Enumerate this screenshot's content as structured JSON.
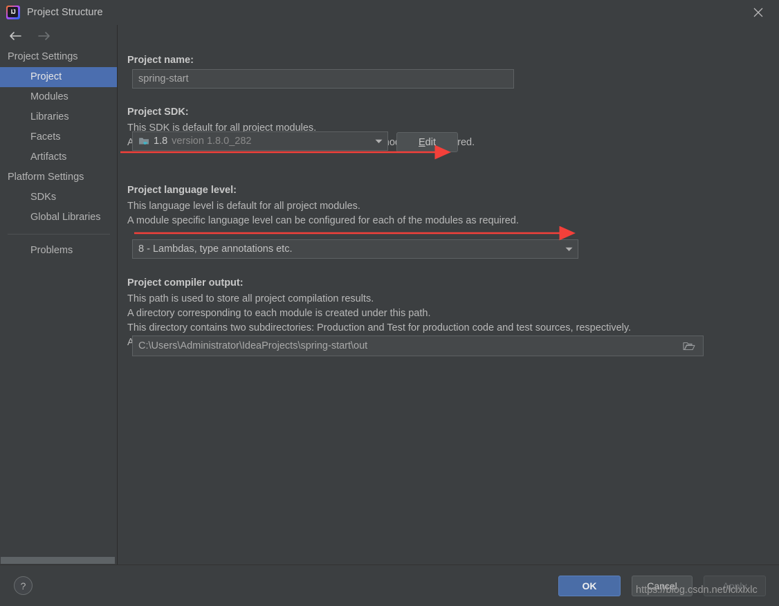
{
  "window": {
    "title": "Project Structure",
    "logo_text": "IJ",
    "logo_icon": "intellij-idea-logo",
    "close_icon": "close-icon"
  },
  "sidebar": {
    "back_icon": "arrow-left-icon",
    "forward_icon": "arrow-right-icon",
    "groups": [
      {
        "label": "Project Settings",
        "items": [
          {
            "label": "Project",
            "selected": true
          },
          {
            "label": "Modules",
            "selected": false
          },
          {
            "label": "Libraries",
            "selected": false
          },
          {
            "label": "Facets",
            "selected": false
          },
          {
            "label": "Artifacts",
            "selected": false
          }
        ]
      },
      {
        "label": "Platform Settings",
        "items": [
          {
            "label": "SDKs",
            "selected": false
          },
          {
            "label": "Global Libraries",
            "selected": false
          }
        ]
      }
    ],
    "extra_items": [
      {
        "label": "Problems",
        "selected": false
      }
    ]
  },
  "main": {
    "project_name": {
      "label": "Project name:",
      "value": "spring-start"
    },
    "project_sdk": {
      "label": "Project SDK:",
      "desc_line1": "This SDK is default for all project modules.",
      "desc_line2": "A module specific SDK can be configured for each of the modules as required.",
      "sdk_icon": "java-sdk-folder-icon",
      "sdk_name": "1.8",
      "sdk_version": "version 1.8.0_282",
      "dropdown_icon": "chevron-down-icon",
      "edit_button_mnemonic": "E",
      "edit_button_rest": "dit"
    },
    "language_level": {
      "label": "Project language level:",
      "desc_line1": "This language level is default for all project modules.",
      "desc_line2": "A module specific language level can be configured for each of the modules as required.",
      "value": "8 - Lambdas, type annotations etc.",
      "dropdown_icon": "chevron-down-icon"
    },
    "compiler_output": {
      "label": "Project compiler output:",
      "desc_line1": "This path is used to store all project compilation results.",
      "desc_line2": "A directory corresponding to each module is created under this path.",
      "desc_line3": "This directory contains two subdirectories: Production and Test for production code and test sources, respectively.",
      "desc_line4": "A module specific compiler output path can be configured for each of the modules as required.",
      "path": "C:\\Users\\Administrator\\IdeaProjects\\spring-start\\out",
      "browse_icon": "folder-open-icon"
    }
  },
  "footer": {
    "help_label": "?",
    "help_icon": "help-icon",
    "ok_label": "OK",
    "cancel_label": "Cancel",
    "apply_label": "Apply"
  },
  "annotations": {
    "watermark": "https://blog.csdn.net/lclxlxlc",
    "arrow_color": "#f4403a",
    "arrows": [
      {
        "name": "sdk-highlight-arrow"
      },
      {
        "name": "language-level-highlight-arrow"
      }
    ]
  }
}
